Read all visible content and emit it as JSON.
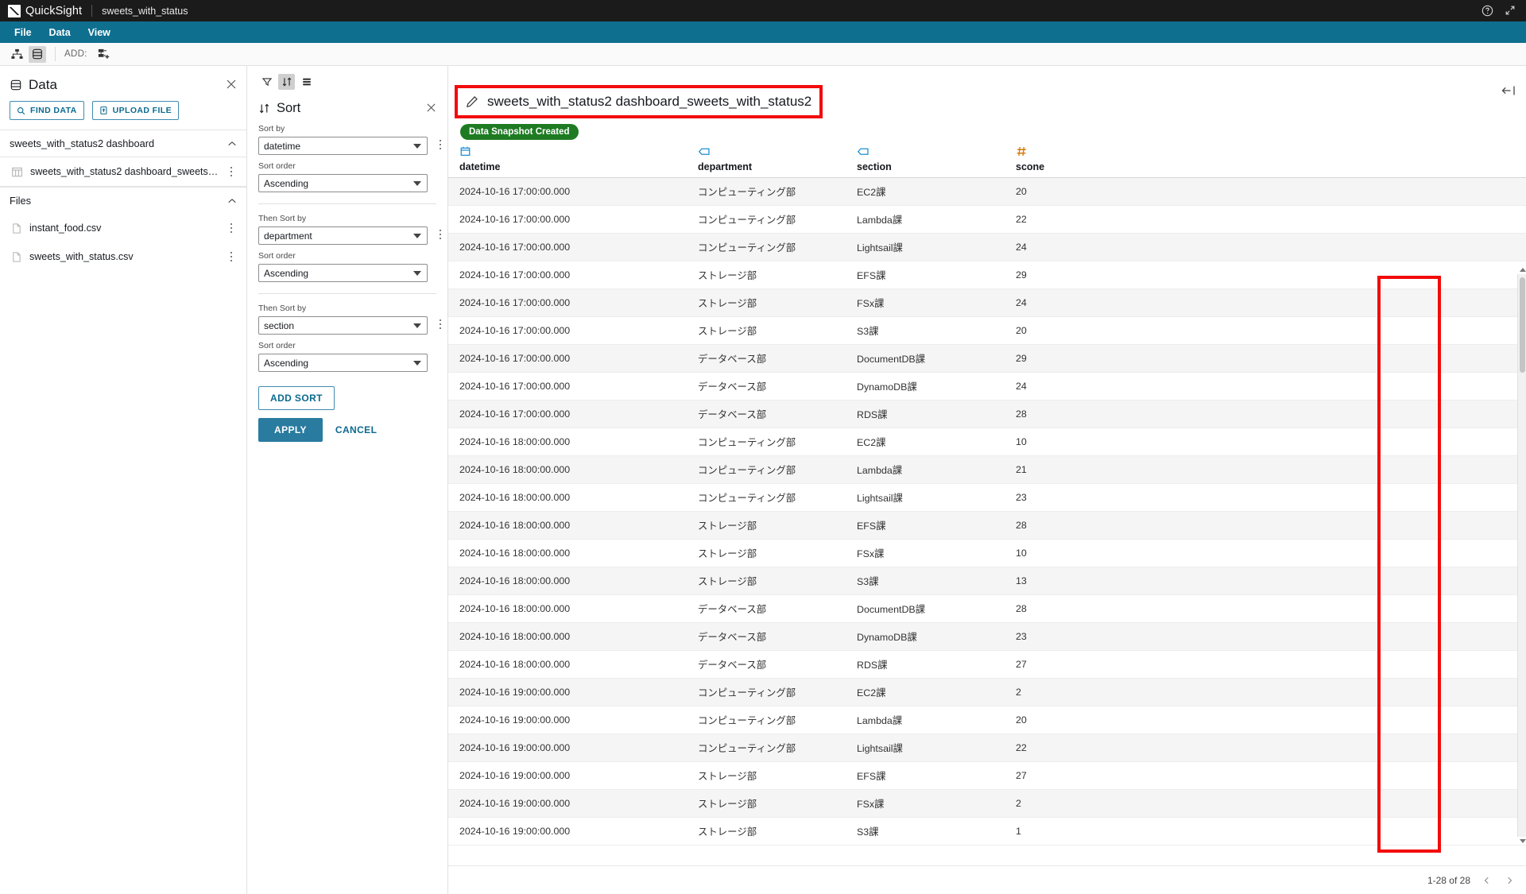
{
  "topbar": {
    "app_name": "QuickSight",
    "document_name": "sweets_with_status",
    "help_icon": "help-circle-icon",
    "expand_icon": "expand-icon"
  },
  "menubar": {
    "items": [
      {
        "label": "File"
      },
      {
        "label": "Data"
      },
      {
        "label": "View"
      }
    ]
  },
  "toolbar": {
    "hierarchy_icon": "hierarchy-icon",
    "database_icon": "database-icon",
    "add_label": "ADD:",
    "add_icon": "add-dataset-icon"
  },
  "left_panel": {
    "title": "Data",
    "title_icon": "database-icon",
    "close_icon": "close-icon",
    "find_data_label": "FIND DATA",
    "find_data_icon": "search-icon",
    "upload_file_label": "UPLOAD FILE",
    "upload_file_icon": "upload-file-icon",
    "dataset_section": {
      "label": "sweets_with_status2 dashboard",
      "chevron": "chevron-up-icon",
      "items": [
        {
          "label": "sweets_with_status2 dashboard_sweets_with...",
          "icon": "table-icon"
        }
      ]
    },
    "files_section": {
      "label": "Files",
      "chevron": "chevron-up-icon",
      "items": [
        {
          "label": "instant_food.csv",
          "icon": "file-icon"
        },
        {
          "label": "sweets_with_status.csv",
          "icon": "file-icon"
        }
      ]
    }
  },
  "sort_panel": {
    "tools": [
      {
        "name": "filter-icon",
        "active": false
      },
      {
        "name": "sort-icon",
        "active": true
      },
      {
        "name": "fields-icon",
        "active": false
      }
    ],
    "title": "Sort",
    "title_icon": "sort-icon",
    "close_icon": "close-icon",
    "groups": [
      {
        "sort_by_label": "Sort by",
        "sort_by_value": "datetime",
        "sort_order_label": "Sort order",
        "sort_order_value": "Ascending"
      },
      {
        "sort_by_label": "Then Sort by",
        "sort_by_value": "department",
        "sort_order_label": "Sort order",
        "sort_order_value": "Ascending"
      },
      {
        "sort_by_label": "Then Sort by",
        "sort_by_value": "section",
        "sort_order_label": "Sort order",
        "sort_order_value": "Ascending"
      }
    ],
    "add_sort_label": "ADD SORT",
    "apply_label": "APPLY",
    "cancel_label": "CANCEL"
  },
  "content": {
    "pencil_icon": "pencil-icon",
    "dataset_title": "sweets_with_status2 dashboard_sweets_with_status2",
    "status_badge": "Data Snapshot Created",
    "collapse_icon": "collapse-right-icon",
    "highlight_color": "#f30b0b",
    "accent_color": "#0f6f8f"
  },
  "table": {
    "columns": [
      {
        "name": "datetime",
        "type_icon": "calendar-icon"
      },
      {
        "name": "department",
        "type_icon": "string-tag-icon"
      },
      {
        "name": "section",
        "type_icon": "string-tag-icon"
      },
      {
        "name": "scone",
        "type_icon": "number-hash-icon"
      }
    ],
    "rows": [
      {
        "datetime": "2024-10-16 17:00:00.000",
        "department": "コンピューティング部",
        "section": "EC2課",
        "scone": "20"
      },
      {
        "datetime": "2024-10-16 17:00:00.000",
        "department": "コンピューティング部",
        "section": "Lambda課",
        "scone": "22"
      },
      {
        "datetime": "2024-10-16 17:00:00.000",
        "department": "コンピューティング部",
        "section": "Lightsail課",
        "scone": "24"
      },
      {
        "datetime": "2024-10-16 17:00:00.000",
        "department": "ストレージ部",
        "section": "EFS課",
        "scone": "29"
      },
      {
        "datetime": "2024-10-16 17:00:00.000",
        "department": "ストレージ部",
        "section": "FSx課",
        "scone": "24"
      },
      {
        "datetime": "2024-10-16 17:00:00.000",
        "department": "ストレージ部",
        "section": "S3課",
        "scone": "20"
      },
      {
        "datetime": "2024-10-16 17:00:00.000",
        "department": "データベース部",
        "section": "DocumentDB課",
        "scone": "29"
      },
      {
        "datetime": "2024-10-16 17:00:00.000",
        "department": "データベース部",
        "section": "DynamoDB課",
        "scone": "24"
      },
      {
        "datetime": "2024-10-16 17:00:00.000",
        "department": "データベース部",
        "section": "RDS課",
        "scone": "28"
      },
      {
        "datetime": "2024-10-16 18:00:00.000",
        "department": "コンピューティング部",
        "section": "EC2課",
        "scone": "10"
      },
      {
        "datetime": "2024-10-16 18:00:00.000",
        "department": "コンピューティング部",
        "section": "Lambda課",
        "scone": "21"
      },
      {
        "datetime": "2024-10-16 18:00:00.000",
        "department": "コンピューティング部",
        "section": "Lightsail課",
        "scone": "23"
      },
      {
        "datetime": "2024-10-16 18:00:00.000",
        "department": "ストレージ部",
        "section": "EFS課",
        "scone": "28"
      },
      {
        "datetime": "2024-10-16 18:00:00.000",
        "department": "ストレージ部",
        "section": "FSx課",
        "scone": "10"
      },
      {
        "datetime": "2024-10-16 18:00:00.000",
        "department": "ストレージ部",
        "section": "S3課",
        "scone": "13"
      },
      {
        "datetime": "2024-10-16 18:00:00.000",
        "department": "データベース部",
        "section": "DocumentDB課",
        "scone": "28"
      },
      {
        "datetime": "2024-10-16 18:00:00.000",
        "department": "データベース部",
        "section": "DynamoDB課",
        "scone": "23"
      },
      {
        "datetime": "2024-10-16 18:00:00.000",
        "department": "データベース部",
        "section": "RDS課",
        "scone": "27"
      },
      {
        "datetime": "2024-10-16 19:00:00.000",
        "department": "コンピューティング部",
        "section": "EC2課",
        "scone": "2"
      },
      {
        "datetime": "2024-10-16 19:00:00.000",
        "department": "コンピューティング部",
        "section": "Lambda課",
        "scone": "20"
      },
      {
        "datetime": "2024-10-16 19:00:00.000",
        "department": "コンピューティング部",
        "section": "Lightsail課",
        "scone": "22"
      },
      {
        "datetime": "2024-10-16 19:00:00.000",
        "department": "ストレージ部",
        "section": "EFS課",
        "scone": "27"
      },
      {
        "datetime": "2024-10-16 19:00:00.000",
        "department": "ストレージ部",
        "section": "FSx課",
        "scone": "2"
      },
      {
        "datetime": "2024-10-16 19:00:00.000",
        "department": "ストレージ部",
        "section": "S3課",
        "scone": "1"
      }
    ]
  },
  "pager": {
    "range_label": "1-28 of 28",
    "prev_icon": "chevron-left-icon",
    "next_icon": "chevron-right-icon"
  }
}
